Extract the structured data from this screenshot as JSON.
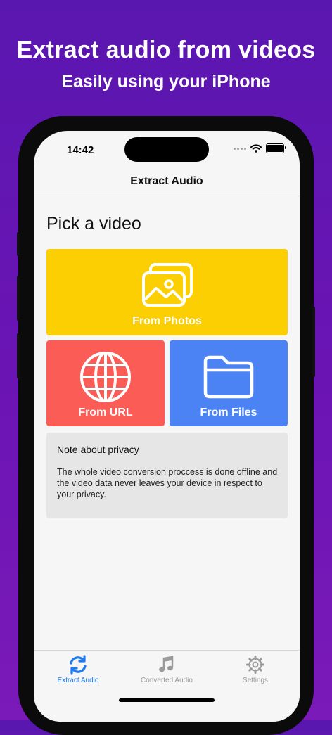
{
  "promo": {
    "headline": "Extract audio from videos",
    "subheadline": "Easily using your iPhone"
  },
  "status_bar": {
    "time": "14:42"
  },
  "nav": {
    "title": "Extract Audio"
  },
  "main": {
    "section_title": "Pick a video",
    "tiles": {
      "photos": {
        "label": "From Photos",
        "icon": "photos-icon",
        "color": "#fccf03"
      },
      "url": {
        "label": "From URL",
        "icon": "globe-icon",
        "color": "#fb5c55"
      },
      "files": {
        "label": "From Files",
        "icon": "folder-icon",
        "color": "#4b82f4"
      }
    },
    "privacy": {
      "title": "Note about privacy",
      "text": "The whole video conversion proccess is done offline and the video data never leaves your device in respect to your privacy."
    }
  },
  "tabbar": {
    "tabs": [
      {
        "label": "Extract Audio",
        "icon": "sync-arrows-icon",
        "active": true
      },
      {
        "label": "Converted Audio",
        "icon": "music-note-icon",
        "active": false
      },
      {
        "label": "Settings",
        "icon": "gear-icon",
        "active": false
      }
    ],
    "accent": "#1e7bf0"
  },
  "colors": {
    "background": "#6414b2"
  }
}
